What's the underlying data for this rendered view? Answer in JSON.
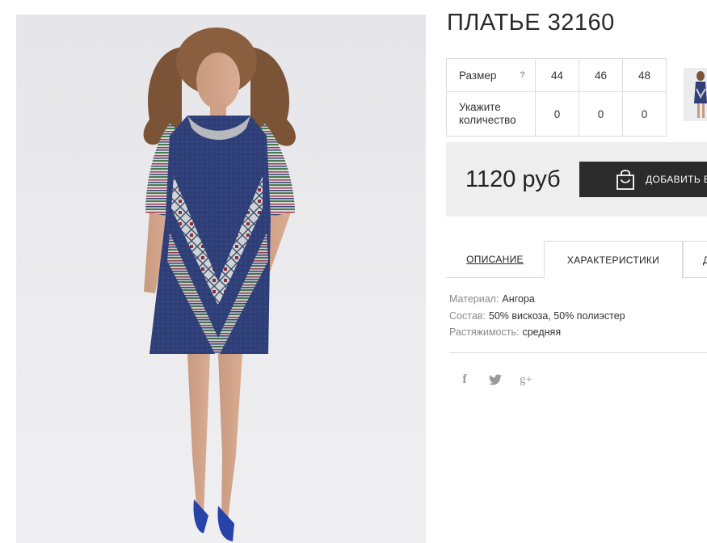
{
  "product": {
    "title": "ПЛАТЬЕ 32160",
    "photo_icon": "dress-photo",
    "thumbnail_icon": "dress-thumbnail"
  },
  "sizes": {
    "size_label": "Размер",
    "help_mark": "?",
    "quantity_label": "Укажите количество",
    "columns": [
      {
        "size": "44",
        "quantity": "0"
      },
      {
        "size": "46",
        "quantity": "0"
      },
      {
        "size": "48",
        "quantity": "0"
      }
    ]
  },
  "purchase": {
    "price": "1120 руб",
    "add_to_cart_label": "ДОБАВИТЬ В",
    "cart_icon": "shopping-bag-icon"
  },
  "tabs": [
    {
      "label": "ОПИСАНИЕ",
      "active": false
    },
    {
      "label": "ХАРАКТЕРИСТИКИ",
      "active": true
    },
    {
      "label": "Д",
      "active": false
    }
  ],
  "characteristics": [
    {
      "key": "Материал:",
      "value": "Ангора"
    },
    {
      "key": "Состав:",
      "value": "50% вискоза, 50% полиэстер"
    },
    {
      "key": "Растяжимость:",
      "value": "средняя"
    }
  ],
  "social": {
    "facebook_icon": "facebook-icon",
    "twitter_icon": "twitter-icon",
    "googleplus_icon": "google-plus-icon",
    "facebook_glyph": "f",
    "googleplus_glyph": "g+"
  },
  "colors": {
    "button_dark": "#2b2b2b",
    "panel_gray": "#eeeeee",
    "dress_navy": "#2e3f78",
    "border": "#dcdcdc"
  }
}
